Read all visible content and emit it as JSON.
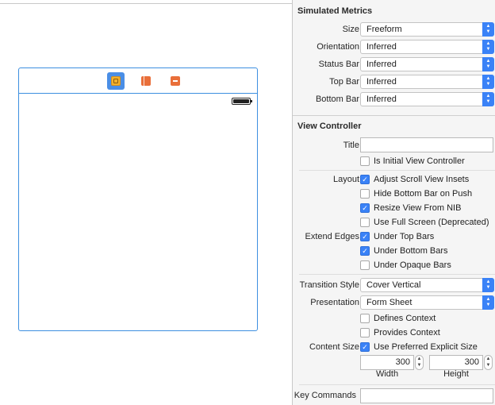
{
  "canvas": {
    "dock_icons": [
      "view-controller-icon",
      "first-responder-icon",
      "exit-icon"
    ]
  },
  "simulated_metrics": {
    "title": "Simulated Metrics",
    "rows": [
      {
        "label": "Size",
        "value": "Freeform"
      },
      {
        "label": "Orientation",
        "value": "Inferred"
      },
      {
        "label": "Status Bar",
        "value": "Inferred"
      },
      {
        "label": "Top Bar",
        "value": "Inferred"
      },
      {
        "label": "Bottom Bar",
        "value": "Inferred"
      }
    ]
  },
  "view_controller": {
    "title": "View Controller",
    "title_label": "Title",
    "title_value": "",
    "is_initial": {
      "label": "Is Initial View Controller",
      "checked": false
    },
    "layout_label": "Layout",
    "layout": [
      {
        "label": "Adjust Scroll View Insets",
        "checked": true
      },
      {
        "label": "Hide Bottom Bar on Push",
        "checked": false
      },
      {
        "label": "Resize View From NIB",
        "checked": true
      },
      {
        "label": "Use Full Screen (Deprecated)",
        "checked": false
      }
    ],
    "extend_edges_label": "Extend Edges",
    "extend_edges": [
      {
        "label": "Under Top Bars",
        "checked": true
      },
      {
        "label": "Under Bottom Bars",
        "checked": true
      },
      {
        "label": "Under Opaque Bars",
        "checked": false
      }
    ],
    "transition_style": {
      "label": "Transition Style",
      "value": "Cover Vertical"
    },
    "presentation": {
      "label": "Presentation",
      "value": "Form Sheet"
    },
    "defines_context": {
      "label": "Defines Context",
      "checked": false
    },
    "provides_context": {
      "label": "Provides Context",
      "checked": false
    },
    "content_size": {
      "label": "Content Size",
      "checkbox": {
        "label": "Use Preferred Explicit Size",
        "checked": true
      },
      "width": {
        "value": "300",
        "label": "Width"
      },
      "height": {
        "value": "300",
        "label": "Height"
      }
    },
    "key_commands": {
      "label": "Key Commands",
      "value": ""
    }
  }
}
